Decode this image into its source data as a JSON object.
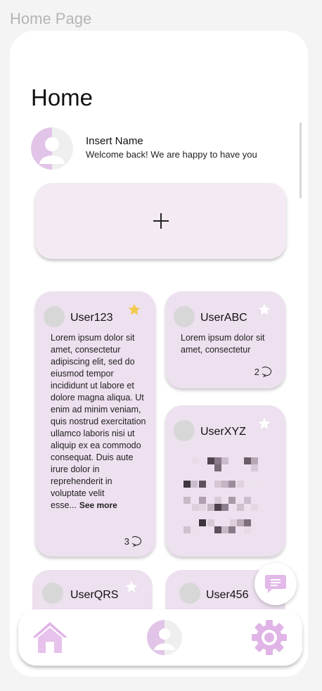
{
  "page_label": "Home Page",
  "header": {
    "title": "Home"
  },
  "profile": {
    "name": "Insert Name",
    "welcome": "Welcome back! We are happy to have you"
  },
  "add_post": {
    "icon": "plus-icon"
  },
  "posts": [
    {
      "user": "User123",
      "starred": true,
      "text": "Lorem ipsum dolor sit amet, consectetur adipiscing elit, sed do eiusmod tempor incididunt ut labore et dolore magna aliqua. Ut enim ad minim veniam, quis nostrud exercitation ullamco laboris nisi ut aliquip ex ea commodo consequat. Duis aute irure dolor in reprehenderit in voluptate velit esse...",
      "see_more": "See more",
      "comments": "3"
    },
    {
      "user": "UserABC",
      "starred": false,
      "text": "Lorem ipsum dolor sit amet, consectetur",
      "comments": "2"
    },
    {
      "user": "UserXYZ",
      "starred": false,
      "content_type": "pixelated-image"
    },
    {
      "user": "UserQRS",
      "starred": false
    },
    {
      "user": "User456",
      "starred": false
    }
  ],
  "colors": {
    "accent": "#e2b9e8",
    "card": "#ede0ef",
    "add_card": "#f3eaf4",
    "star_active": "#f2c94c",
    "star_inactive": "#ffffff"
  },
  "nav": {
    "items": [
      {
        "icon": "home-icon"
      },
      {
        "icon": "profile-icon"
      },
      {
        "icon": "settings-icon"
      }
    ]
  },
  "fab": {
    "icon": "chat-icon"
  }
}
